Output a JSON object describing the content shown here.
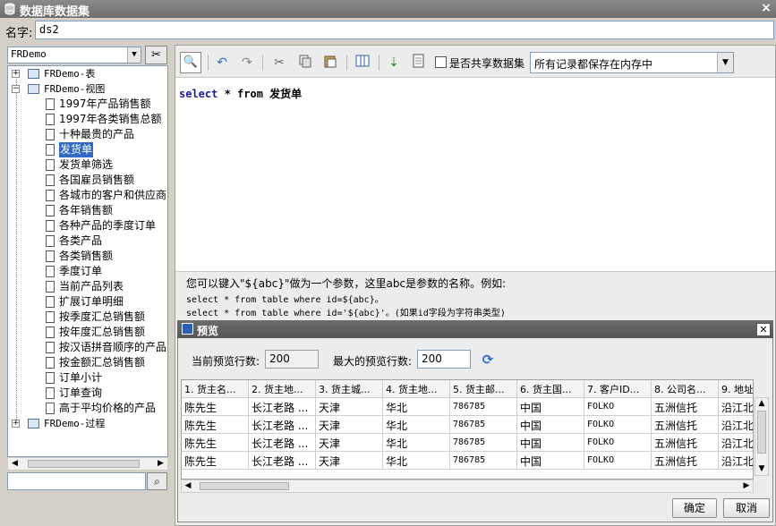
{
  "window": {
    "title": "数据库数据集",
    "close": "×"
  },
  "name_field": {
    "label": "名字:",
    "value": "ds2"
  },
  "db_select": {
    "value": "FRDemo"
  },
  "tree": {
    "nodes": [
      {
        "label": "FRDemo-表",
        "expander": "+"
      },
      {
        "label": "FRDemo-视图",
        "expander": "−"
      },
      {
        "label": "1997年产品销售额"
      },
      {
        "label": "1997年各类销售总额"
      },
      {
        "label": "十种最贵的产品"
      },
      {
        "label": "发货单"
      },
      {
        "label": "发货单筛选"
      },
      {
        "label": "各国雇员销售额"
      },
      {
        "label": "各城市的客户和供应商"
      },
      {
        "label": "各年销售额"
      },
      {
        "label": "各种产品的季度订单"
      },
      {
        "label": "各类产品"
      },
      {
        "label": "各类销售额"
      },
      {
        "label": "季度订单"
      },
      {
        "label": "当前产品列表"
      },
      {
        "label": "扩展订单明细"
      },
      {
        "label": "按季度汇总销售额"
      },
      {
        "label": "按年度汇总销售额"
      },
      {
        "label": "按汉语拼音顺序的产品列"
      },
      {
        "label": "按金额汇总销售额"
      },
      {
        "label": "订单小计"
      },
      {
        "label": "订单查询"
      },
      {
        "label": "高于平均价格的产品"
      },
      {
        "label": "FRDemo-过程",
        "expander": "+"
      }
    ]
  },
  "toolbar": {
    "share_label": "是否共享数据集",
    "memory_option": "所有记录都保存在内存中"
  },
  "sql": {
    "kw1": "select",
    "rest1": " *",
    "kw2": "from",
    "rest2": " 发货单"
  },
  "hint": {
    "line1": "您可以键入\"${abc}\"做为一个参数，这里abc是参数的名称。例如:",
    "line2": "select * from table where id=${abc}。",
    "line3": "select * from table where id='${abc}'。(如果id字段为字符串类型)"
  },
  "preview": {
    "title": "预览",
    "current_label": "当前预览行数:",
    "current_value": "200",
    "max_label": "最大的预览行数:",
    "max_value": "200",
    "columns": [
      "1. 货主名...",
      "2. 货主地...",
      "3. 货主城...",
      "4. 货主地...",
      "5. 货主邮...",
      "6. 货主国...",
      "7. 客户ID...",
      "8. 公司名...",
      "9. 地址"
    ],
    "rows": [
      [
        "陈先生",
        "长江老路 ...",
        "天津",
        "华北",
        "786785",
        "中国",
        "FOLKO",
        "五洲信托",
        "沿江北"
      ],
      [
        "陈先生",
        "长江老路 ...",
        "天津",
        "华北",
        "786785",
        "中国",
        "FOLKO",
        "五洲信托",
        "沿江北"
      ],
      [
        "陈先生",
        "长江老路 ...",
        "天津",
        "华北",
        "786785",
        "中国",
        "FOLKO",
        "五洲信托",
        "沿江北"
      ],
      [
        "陈先生",
        "长江老路 ...",
        "天津",
        "华北",
        "786785",
        "中国",
        "FOLKO",
        "五洲信托",
        "沿江北"
      ]
    ],
    "ok": "确定",
    "cancel": "取消"
  }
}
